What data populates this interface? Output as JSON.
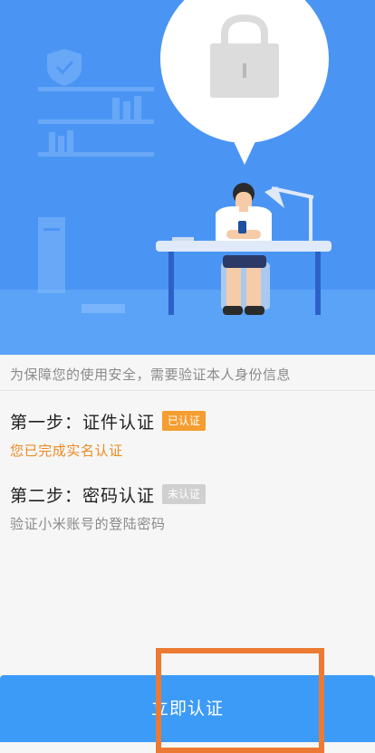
{
  "intro": {
    "text": "为保障您的使用安全，需要验证本人身份信息"
  },
  "steps": [
    {
      "title": "第一步：证件认证",
      "badge": "已认证",
      "description": "您已完成实名认证"
    },
    {
      "title": "第二步：密码认证",
      "badge": "未认证",
      "description": "验证小米账号的登陆密码"
    }
  ],
  "action": {
    "label": "立即认证"
  },
  "colors": {
    "hero_background": "#4a95f4",
    "action_button": "#3c9bf7",
    "badge_done": "#f49d30",
    "badge_todo": "#d0d0d0",
    "highlight": "#ec7a33"
  },
  "icons": {
    "hero": "security-verification-illustration",
    "lock": "lock-icon",
    "shield": "shield-icon"
  }
}
